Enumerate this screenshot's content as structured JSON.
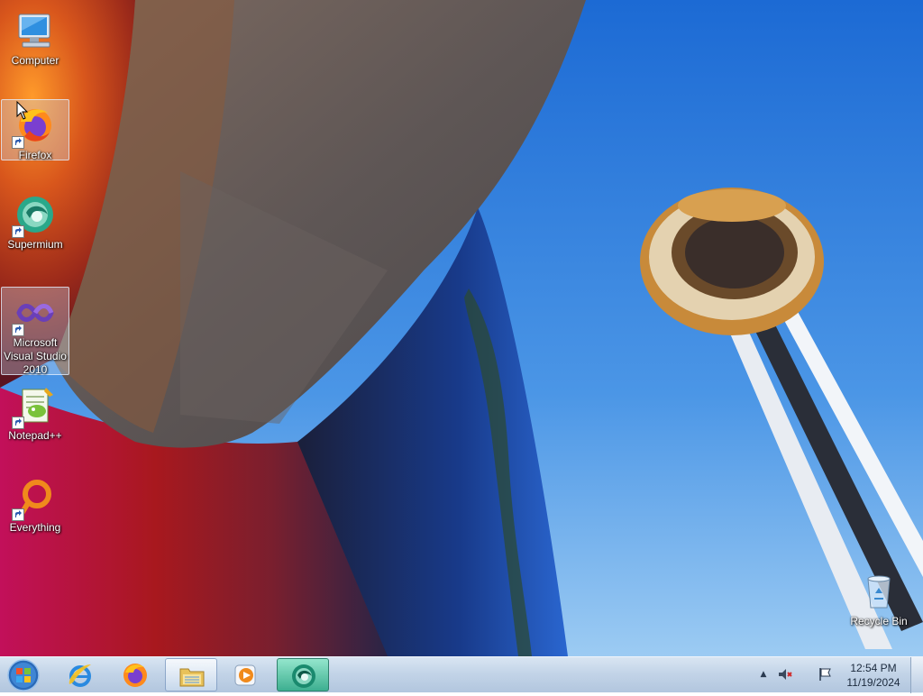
{
  "desktop": {
    "icons": [
      {
        "label": "Computer",
        "icon": "computer-icon",
        "shortcut": false
      },
      {
        "label": "Firefox",
        "icon": "firefox-icon",
        "shortcut": true,
        "selected": true
      },
      {
        "label": "Supermium",
        "icon": "supermium-icon",
        "shortcut": true
      },
      {
        "label": "Microsoft Visual Studio 2010",
        "icon": "visual-studio-icon",
        "shortcut": true,
        "selected": true
      },
      {
        "label": "Notepad++",
        "icon": "notepad-plus-plus-icon",
        "shortcut": true
      },
      {
        "label": "Everything",
        "icon": "everything-search-icon",
        "shortcut": true
      }
    ],
    "recycle_bin": {
      "label": "Recycle Bin",
      "icon": "recycle-bin-icon"
    }
  },
  "taskbar": {
    "pinned": [
      {
        "name": "internet-explorer",
        "icon": "internet-explorer-icon",
        "state": "pinned"
      },
      {
        "name": "firefox",
        "icon": "firefox-icon",
        "state": "pinned"
      },
      {
        "name": "windows-explorer",
        "icon": "folder-icon",
        "state": "running"
      },
      {
        "name": "media-player",
        "icon": "media-player-icon",
        "state": "pinned"
      },
      {
        "name": "supermium",
        "icon": "supermium-icon",
        "state": "active"
      }
    ],
    "tray": {
      "show_hidden": "▲",
      "volume": "volume-muted-icon",
      "action_center": "flag-icon"
    },
    "clock": {
      "time": "12:54 PM",
      "date": "11/19/2024"
    }
  },
  "colors": {
    "sky": "#2f7fe0",
    "taskbar": "#c3d4e8",
    "accent_orange": "#f08a1c",
    "supermium_teal": "#2aa88a"
  }
}
